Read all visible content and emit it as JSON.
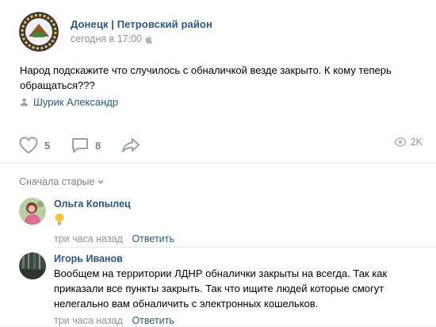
{
  "post": {
    "group_name": "Донецк | Петровский район",
    "time": "сегодня в 17:00",
    "text": "Народ подскажите что случилось с обналичкой везде закрыто. К кому теперь обращаться???",
    "signer": "Шурик Александр",
    "icons": {
      "time": "apple-icon",
      "signer": "person-icon"
    }
  },
  "actions": {
    "likes": "5",
    "comments": "8",
    "views": "2K",
    "icons": [
      "heart-icon",
      "comment-icon",
      "share-icon",
      "eye-icon"
    ]
  },
  "comments_section": {
    "sort_label": "Сначала старые",
    "items": [
      {
        "author": "Ольга Копылец",
        "text": "",
        "emoji": "lightbulb",
        "time": "три часа назад",
        "reply_label": "Ответить"
      },
      {
        "author": "Игорь Иванов",
        "text": "Вообщем на территории ЛДНР обналички закрыты на всегда. Так как приказали все пункты закрыть. Так что ищите людей которые смогут нелегально вам обналичить с электронных кошельков.",
        "time": "три часа назад",
        "reply_label": "Ответить"
      }
    ]
  },
  "colors": {
    "link": "#2a5885",
    "muted": "#939393",
    "icon": "#99a2ad"
  }
}
